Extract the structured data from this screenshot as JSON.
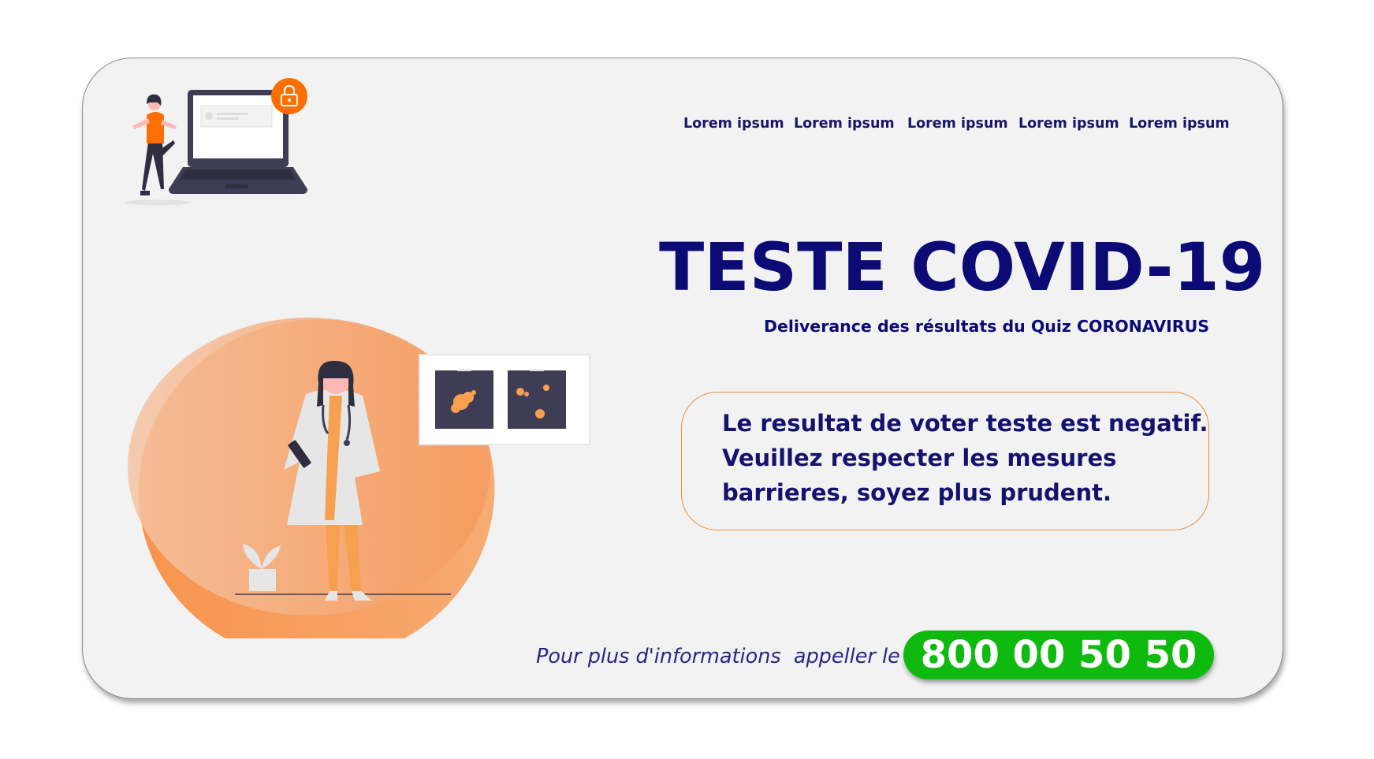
{
  "nav": {
    "items": [
      {
        "label": "Lorem ipsum"
      },
      {
        "label": "Lorem ipsum"
      },
      {
        "label": "Lorem ipsum"
      },
      {
        "label": "Lorem ipsum"
      },
      {
        "label": "Lorem ipsum"
      }
    ]
  },
  "hero": {
    "title": "TESTE COVID-19",
    "subtitle": "Deliverance des résultats du Quiz CORONAVIRUS"
  },
  "result": {
    "lines": [
      "Le resultat de voter teste est negatif.",
      "Veuillez respecter les mesures",
      "barrieres, soyez plus prudent."
    ]
  },
  "contact": {
    "info_text": "Pour plus d'informations  appeller le",
    "phone": "800 00 50 50"
  },
  "icons": {
    "lock": "lock-icon",
    "laptop": "laptop-illustration",
    "doctor": "doctor-illustration"
  },
  "colors": {
    "navy": "#0c0a75",
    "orange": "#f7893b",
    "green": "#0fba0f",
    "card": "#f2f2f2"
  }
}
